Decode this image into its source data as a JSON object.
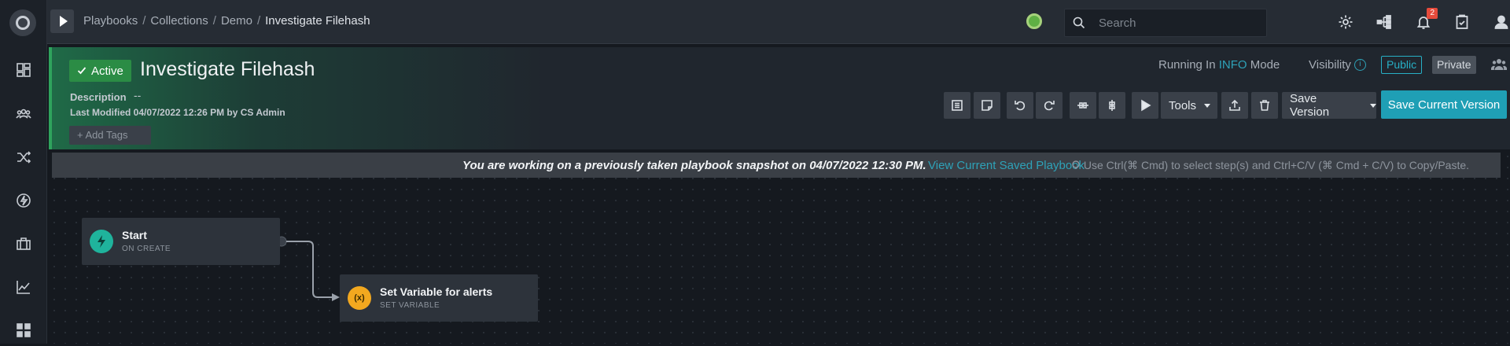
{
  "breadcrumb": [
    "Playbooks",
    "Collections",
    "Demo"
  ],
  "breadcrumb_current": "Investigate Filehash",
  "breadcrumb_separator": "/",
  "search": {
    "placeholder": "Search"
  },
  "notifications": {
    "count": "2"
  },
  "playbook": {
    "status": "Active",
    "title": "Investigate Filehash",
    "description_label": "Description",
    "description_value": "--",
    "last_modified": "Last Modified 04/07/2022 12:26 PM by CS Admin",
    "add_tags": "+ Add Tags"
  },
  "mode": {
    "prefix": "Running In",
    "mode": "INFO",
    "suffix": "Mode"
  },
  "visibility": {
    "label": "Visibility",
    "info": "i",
    "public": "Public",
    "private": "Private"
  },
  "toolbar": {
    "tools": "Tools",
    "save_version": "Save Version",
    "save_current": "Save Current Version"
  },
  "snapshot": {
    "message": "You are working on a previously taken playbook snapshot on 04/07/2022 12:30 PM.",
    "link": "View Current Saved Playbook",
    "hint": "Use Ctrl(⌘ Cmd) to select step(s) and Ctrl+C/V (⌘ Cmd + C/V) to Copy/Paste."
  },
  "nodes": [
    {
      "name": "Start",
      "subtitle": "ON CREATE",
      "icon": "lightning-icon"
    },
    {
      "name": "Set Variable for alerts",
      "subtitle": "SET VARIABLE",
      "icon": "(x)"
    }
  ],
  "colors": {
    "accent": "#1f9fb5",
    "active": "#2b8c45",
    "start_node": "#1fb39c",
    "variable_node": "#f2a81f"
  }
}
